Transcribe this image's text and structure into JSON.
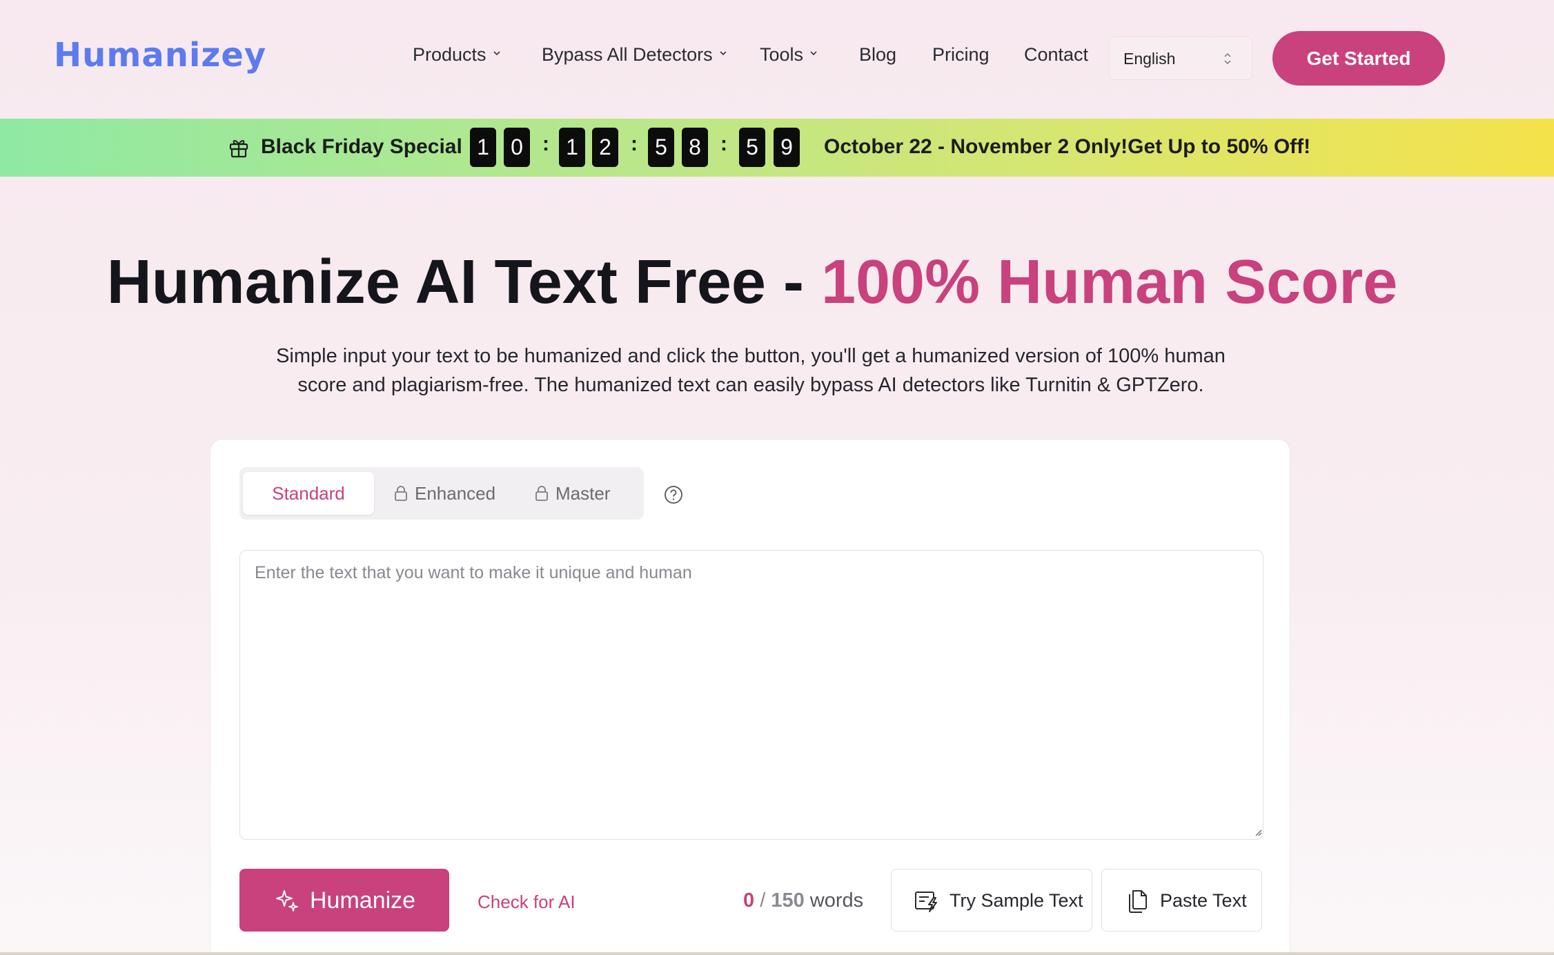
{
  "brand": {
    "name": "Humanizey",
    "color": "#5b7bef"
  },
  "nav": {
    "items": [
      {
        "label": "Products",
        "dropdown": true
      },
      {
        "label": "Bypass All Detectors",
        "dropdown": true
      },
      {
        "label": "Tools",
        "dropdown": true
      },
      {
        "label": "Blog",
        "dropdown": false
      },
      {
        "label": "Pricing",
        "dropdown": false
      },
      {
        "label": "Contact",
        "dropdown": false
      }
    ],
    "language": "English",
    "cta_label": "Get Started"
  },
  "promo": {
    "label": "Black Friday Special :",
    "countdown": [
      "1",
      "0",
      "1",
      "2",
      "5",
      "8",
      "5",
      "9"
    ],
    "separator": ":",
    "offer": "October 22 - November 2 Only!Get Up to 50% Off!"
  },
  "hero": {
    "title_main": "Humanize AI Text Free - ",
    "title_accent": "100% Human Score",
    "subtitle": "Simple input your text to be humanized and click the button, you'll get a humanized version of 100% human score and plagiarism-free. The humanized text can easily bypass AI detectors like Turnitin & GPTZero."
  },
  "editor": {
    "modes": [
      {
        "label": "Standard",
        "locked": false,
        "active": true
      },
      {
        "label": "Enhanced",
        "locked": true,
        "active": false
      },
      {
        "label": "Master",
        "locked": true,
        "active": false
      }
    ],
    "input_value": "",
    "placeholder": "Enter the text that you want to make it unique and human",
    "humanize_label": "Humanize",
    "check_ai_label": "Check for AI",
    "word_count": {
      "current": "0",
      "separator": " / ",
      "max": "150",
      "unit": " words"
    },
    "sample_label": "Try Sample Text",
    "paste_label": "Paste Text"
  },
  "colors": {
    "accent": "#c9417d",
    "brand": "#5b7bef"
  },
  "icons": [
    "chevron-down-icon",
    "updown-icon",
    "gift-icon",
    "lock-icon",
    "help-icon",
    "sparkle-icon",
    "sample-text-icon",
    "paste-icon",
    "resize-grip-icon"
  ]
}
